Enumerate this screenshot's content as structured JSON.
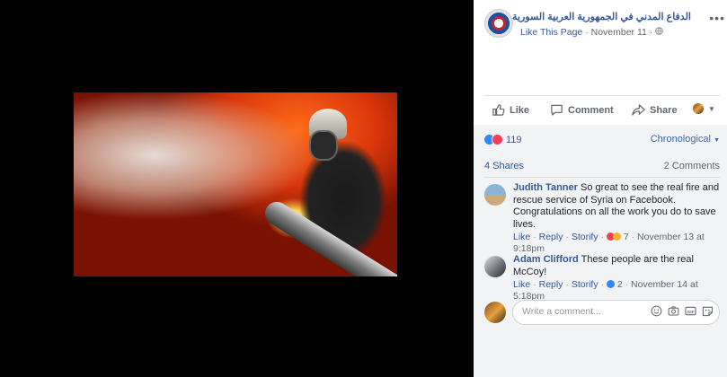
{
  "post": {
    "page_name": "الدفاع المدني في الجمهورية العربية السورية",
    "like_page": "Like This Page",
    "date": "November 11",
    "meta_sep": "·"
  },
  "icons": {
    "more": "more-options-icon",
    "like": "thumbs-up-icon",
    "comment": "speech-bubble-icon",
    "share": "share-arrow-icon",
    "globe": "globe-icon"
  },
  "actions": {
    "like": "Like",
    "comment": "Comment",
    "share": "Share"
  },
  "reactions": {
    "count": "119",
    "order": "Chronological"
  },
  "stats": {
    "shares": "4 Shares",
    "comments": "2 Comments"
  },
  "comments": [
    {
      "author": "Judith Tanner",
      "text": "So great to see the real fire and rescue service of Syria on Facebook. Congratulations on all the work you do to save lives.",
      "like": "Like",
      "reply": "Reply",
      "storify": "Storify",
      "reactions": "7",
      "time": "November 13 at 9:18pm"
    },
    {
      "author": "Adam Clifford",
      "text": "These people are the real McCoy!",
      "like": "Like",
      "reply": "Reply",
      "storify": "Storify",
      "reactions": "2",
      "time": "November 14 at 5:18pm"
    }
  ],
  "composer": {
    "placeholder": "Write a comment..."
  },
  "colors": {
    "link": "#365899",
    "accent": "#4267b2",
    "like_blue": "#2d88ff",
    "love_red": "#f33e58"
  }
}
